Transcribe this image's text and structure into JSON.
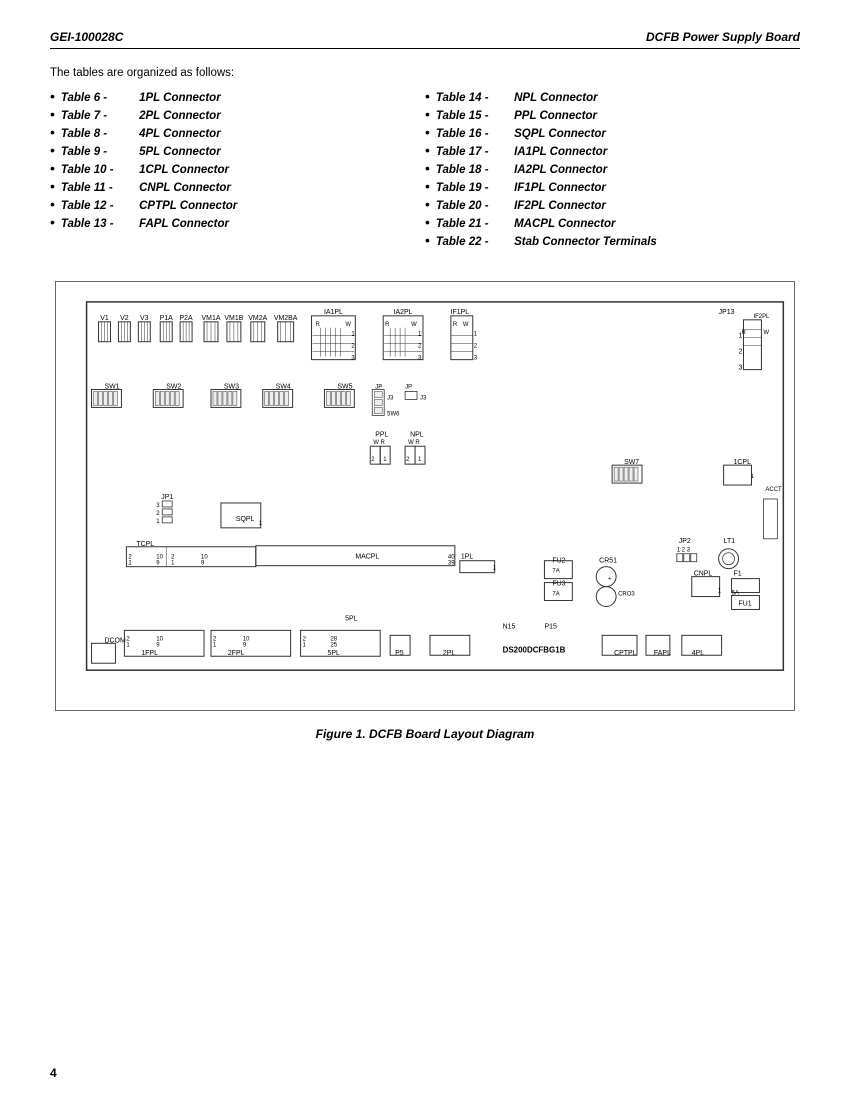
{
  "header": {
    "left": "GEI-100028C",
    "right": "DCFB Power Supply Board"
  },
  "intro": {
    "text": "The tables are organized as follows:"
  },
  "left_tables": [
    {
      "num": "Table 6 -",
      "desc": "1PL Connector"
    },
    {
      "num": "Table 7 -",
      "desc": "2PL Connector"
    },
    {
      "num": "Table 8 -",
      "desc": "4PL Connector"
    },
    {
      "num": "Table 9 -",
      "desc": "5PL Connector"
    },
    {
      "num": "Table 10 -",
      "desc": "1CPL Connector"
    },
    {
      "num": "Table 11 -",
      "desc": "CNPL Connector"
    },
    {
      "num": "Table 12 -",
      "desc": "CPTPL Connector"
    },
    {
      "num": "Table 13 -",
      "desc": "FAPL Connector"
    }
  ],
  "right_tables": [
    {
      "num": "Table 14 -",
      "desc": "NPL Connector"
    },
    {
      "num": "Table 15 -",
      "desc": "PPL Connector"
    },
    {
      "num": "Table 16 -",
      "desc": "SQPL Connector"
    },
    {
      "num": "Table 17 -",
      "desc": "IA1PL Connector"
    },
    {
      "num": "Table 18 -",
      "desc": "IA2PL Connector"
    },
    {
      "num": "Table 19 -",
      "desc": "IF1PL Connector"
    },
    {
      "num": "Table 20 -",
      "desc": "IF2PL Connector"
    },
    {
      "num": "Table 21 -",
      "desc": "MACPL Connector"
    },
    {
      "num": "Table 22 -",
      "desc": "Stab Connector Terminals"
    }
  ],
  "figure": {
    "caption": "Figure 1.  DCFB Board Layout Diagram"
  },
  "page_number": "4"
}
